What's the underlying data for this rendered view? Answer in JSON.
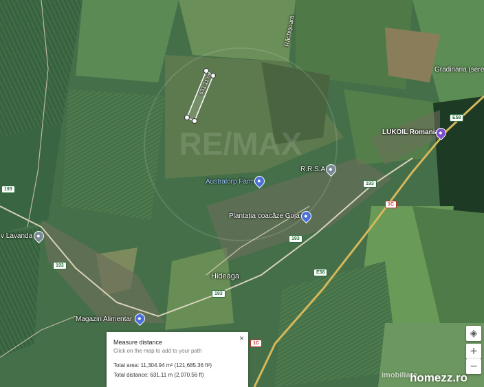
{
  "map": {
    "place_labels": {
      "rachisoara": "Răchișoara",
      "gradinaria": "Gradinaria (sere",
      "lukoil": "LUKOIL Romania",
      "rrsa": "R.R.S.A",
      "australorp": "Australorp Farm",
      "plantatia": "Plantația coacăze Goja",
      "lavanda": "v Lavanda",
      "hideaga": "Hideaga",
      "magazin": "Magazin Alimentar"
    },
    "road_labels": {
      "e58_top": "E58",
      "e58_mid": "E58",
      "r193_left": "193",
      "r193_right": "193",
      "r193_center": "193",
      "r193_lower_left": "193",
      "r193_bottom": "193",
      "r1c_upper": "1C",
      "r1c_lower": "1C"
    },
    "measure_label": "631.11 m"
  },
  "measure_panel": {
    "title": "Measure distance",
    "hint": "Click on the map to add to your path",
    "total_area": "Total area: 11,304.94 m² (121,685.36 ft²)",
    "total_distance": "Total distance: 631.11 m (2,070.56 ft)",
    "close_symbol": "×"
  },
  "controls": {
    "locate_symbol": "◈",
    "zoom_in": "+",
    "zoom_out": "−"
  },
  "watermark": {
    "left_text": "imobiliare",
    "right_text": "homezz.ro"
  }
}
